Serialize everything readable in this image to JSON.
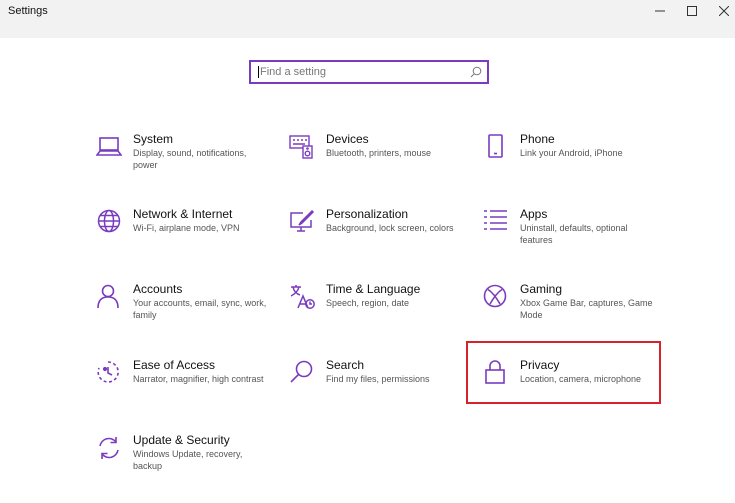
{
  "window": {
    "title": "Settings"
  },
  "search": {
    "placeholder": "Find a setting"
  },
  "accent": "#7a3bbf",
  "highlight_color": "#d4242a",
  "tiles": [
    {
      "name": "System",
      "desc": "Display, sound, notifications, power",
      "icon": "laptop-icon"
    },
    {
      "name": "Devices",
      "desc": "Bluetooth, printers, mouse",
      "icon": "keyboard-speaker-icon"
    },
    {
      "name": "Phone",
      "desc": "Link your Android, iPhone",
      "icon": "phone-icon"
    },
    {
      "name": "Network & Internet",
      "desc": "Wi-Fi, airplane mode, VPN",
      "icon": "globe-icon"
    },
    {
      "name": "Personalization",
      "desc": "Background, lock screen, colors",
      "icon": "paint-monitor-icon"
    },
    {
      "name": "Apps",
      "desc": "Uninstall, defaults, optional features",
      "icon": "apps-list-icon"
    },
    {
      "name": "Accounts",
      "desc": "Your accounts, email, sync, work, family",
      "icon": "person-icon"
    },
    {
      "name": "Time & Language",
      "desc": "Speech, region, date",
      "icon": "time-language-icon"
    },
    {
      "name": "Gaming",
      "desc": "Xbox Game Bar, captures, Game Mode",
      "icon": "xbox-icon"
    },
    {
      "name": "Ease of Access",
      "desc": "Narrator, magnifier, high contrast",
      "icon": "ease-of-access-icon"
    },
    {
      "name": "Search",
      "desc": "Find my files, permissions",
      "icon": "search-icon"
    },
    {
      "name": "Privacy",
      "desc": "Location, camera, microphone",
      "icon": "lock-icon"
    },
    {
      "name": "Update & Security",
      "desc": "Windows Update, recovery, backup",
      "icon": "refresh-icon"
    }
  ]
}
